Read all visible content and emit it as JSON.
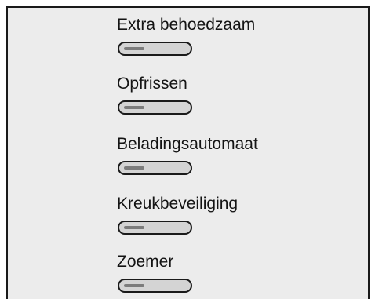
{
  "options": [
    {
      "label": "Extra behoedzaam"
    },
    {
      "label": "Opfrissen"
    },
    {
      "label": "Beladingsautomaat"
    },
    {
      "label": "Kreukbeveiliging"
    },
    {
      "label": "Zoemer"
    }
  ]
}
